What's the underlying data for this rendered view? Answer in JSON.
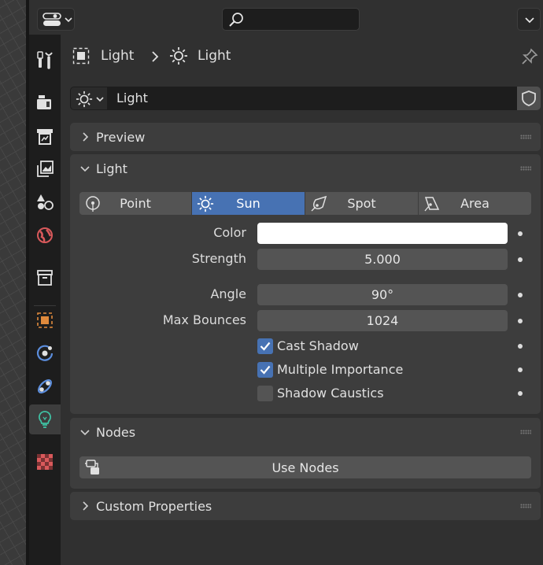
{
  "header": {
    "search_placeholder": ""
  },
  "tabs": [
    {
      "name": "tool",
      "icon": "wrench-screwdriver-icon",
      "active": false
    },
    {
      "name": "render",
      "icon": "camera-back-icon",
      "active": false
    },
    {
      "name": "output",
      "icon": "printer-icon",
      "active": false
    },
    {
      "name": "view-layer",
      "icon": "image-stack-icon",
      "active": false
    },
    {
      "name": "scene",
      "icon": "scene-shapes-icon",
      "active": false
    },
    {
      "name": "world",
      "icon": "globe-icon",
      "active": false
    },
    {
      "name": "collection",
      "icon": "box-icon",
      "active": false
    },
    {
      "name": "object",
      "icon": "object-square-icon",
      "active": false
    },
    {
      "name": "physics",
      "icon": "orbit-icon",
      "active": false
    },
    {
      "name": "constraints",
      "icon": "link-icon",
      "active": false
    },
    {
      "name": "data",
      "icon": "lightbulb-icon",
      "active": true
    },
    {
      "name": "texture",
      "icon": "checker-icon",
      "active": false
    }
  ],
  "breadcrumb": {
    "object_label": "Light",
    "data_label": "Light"
  },
  "datablock": {
    "name": "Light"
  },
  "panels": {
    "preview": {
      "title": "Preview",
      "expanded": false
    },
    "light": {
      "title": "Light",
      "expanded": true,
      "types": [
        {
          "label": "Point",
          "selected": false
        },
        {
          "label": "Sun",
          "selected": true
        },
        {
          "label": "Spot",
          "selected": false
        },
        {
          "label": "Area",
          "selected": false
        }
      ],
      "color": {
        "label": "Color",
        "value": "#ffffff"
      },
      "strength": {
        "label": "Strength",
        "value": "5.000"
      },
      "angle": {
        "label": "Angle",
        "value": "90°"
      },
      "max_bounces": {
        "label": "Max Bounces",
        "value": "1024"
      },
      "cast_shadow": {
        "label": "Cast Shadow",
        "checked": true
      },
      "multiple_importance": {
        "label": "Multiple Importance",
        "checked": true
      },
      "shadow_caustics": {
        "label": "Shadow Caustics",
        "checked": false
      }
    },
    "nodes": {
      "title": "Nodes",
      "expanded": true,
      "use_nodes_label": "Use Nodes"
    },
    "custom_properties": {
      "title": "Custom Properties",
      "expanded": false
    }
  },
  "colors": {
    "accent": "#4772b3",
    "active_tab_icon": "#3fc2a4",
    "object_icon": "#e08a3c",
    "world_icon": "#d9595b",
    "physics_icon": "#5b8ddc"
  }
}
